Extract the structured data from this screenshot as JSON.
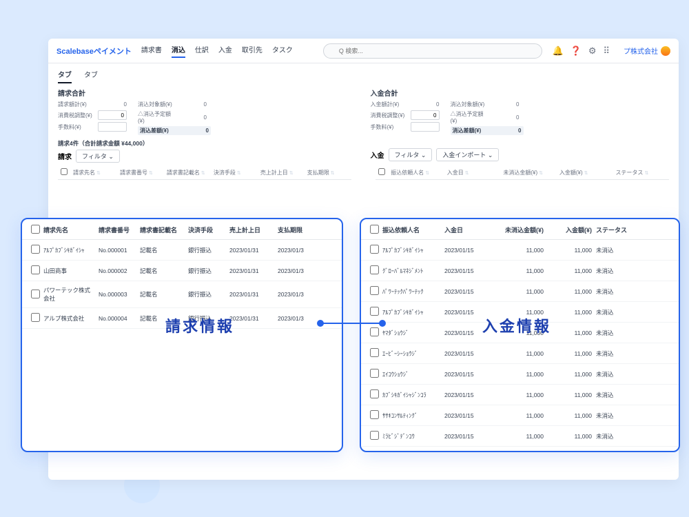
{
  "brand": "Scalebaseペイメント",
  "nav": [
    "請求書",
    "消込",
    "仕訳",
    "入金",
    "取引先",
    "タスク"
  ],
  "nav_active": 1,
  "search_placeholder": "Q 検索...",
  "user": "プ株式会社",
  "subtabs": [
    "タブ",
    "タブ"
  ],
  "left_panel": {
    "title": "請求合計",
    "rows_a": [
      {
        "lbl": "請求額計(¥)",
        "val": "0",
        "input": false
      },
      {
        "lbl": "消費税調整(¥)",
        "val": "0",
        "input": true
      },
      {
        "lbl": "手数料(¥)",
        "val": "",
        "input": true
      }
    ],
    "rows_b": [
      {
        "lbl": "消込対象額(¥)",
        "val": "0",
        "input": false
      },
      {
        "lbl": "△消込予定額(¥)",
        "val": "0",
        "input": false
      },
      {
        "lbl": "消込差額(¥)",
        "val": "0",
        "input": false,
        "hl": true
      }
    ]
  },
  "right_panel": {
    "title": "入金合計",
    "rows_a": [
      {
        "lbl": "入金額計(¥)",
        "val": "0",
        "input": false
      },
      {
        "lbl": "消費税調整(¥)",
        "val": "0",
        "input": true
      },
      {
        "lbl": "手数料(¥)",
        "val": "",
        "input": true
      }
    ],
    "rows_b": [
      {
        "lbl": "消込対象額(¥)",
        "val": "0",
        "input": false
      },
      {
        "lbl": "△消込予定額(¥)",
        "val": "0",
        "input": false
      },
      {
        "lbl": "消込差額(¥)",
        "val": "0",
        "input": false,
        "hl": true
      }
    ]
  },
  "count_text": "請求4件（合計請求金額 ¥44,000）",
  "list_left_title": "請求",
  "list_right_title": "入金",
  "filter": "フィルタ ⌄",
  "import": "入金インポート ⌄",
  "bg_cols_left": [
    "",
    "請求先名",
    "請求書番号",
    "請求書記載名",
    "決済手段",
    "売上計上日",
    "支払期限"
  ],
  "bg_cols_right": [
    "",
    "振込依頼人名",
    "入金日",
    "未消込金額(¥)",
    "入金額(¥)",
    "ステータス"
  ],
  "ov_left": {
    "headers": [
      "",
      "請求先名",
      "請求書番号",
      "請求書記載名",
      "決済手段",
      "売上計上日",
      "支払期限"
    ],
    "rows": [
      [
        "",
        "ｱﾙﾌﾟｶﾌﾞｼｷｶﾞｲｼｬ",
        "No.000001",
        "記載名",
        "銀行振込",
        "2023/01/31",
        "2023/01/3"
      ],
      [
        "",
        "山田商事",
        "No.000002",
        "記載名",
        "銀行振込",
        "2023/01/31",
        "2023/01/3"
      ],
      [
        "",
        "パワーテック株式会社",
        "No.000003",
        "記載名",
        "銀行振込",
        "2023/01/31",
        "2023/01/3"
      ],
      [
        "",
        "アルプ株式会社",
        "No.000004",
        "記載名",
        "銀行振込",
        "2023/01/31",
        "2023/01/3"
      ]
    ]
  },
  "ov_right": {
    "headers": [
      "",
      "振込依頼人名",
      "入金日",
      "未消込金額(¥)",
      "入金額(¥)",
      "ステータス"
    ],
    "rows": [
      [
        "",
        "ｱﾙﾌﾟｶﾌﾞｼｷｶﾞｲｼｬ",
        "2023/01/15",
        "11,000",
        "11,000",
        "未消込"
      ],
      [
        "",
        "ｸﾞﾛｰﾊﾞﾙﾏﾈｼﾞﾒﾝﾄ",
        "2023/01/15",
        "11,000",
        "11,000",
        "未消込"
      ],
      [
        "",
        "ﾊﾟﾜｰﾃｯｸﾊﾟﾜｰﾃｯｸ",
        "2023/01/15",
        "11,000",
        "11,000",
        "未消込"
      ],
      [
        "",
        "ｱﾙﾌﾟｶﾌﾞｼｷｶﾞｲｼｬ",
        "2023/01/15",
        "11,000",
        "11,000",
        "未消込"
      ],
      [
        "",
        "ﾔﾏﾀﾞｼｮｳｼﾞ",
        "2023/01/15",
        "11,000",
        "11,000",
        "未消込"
      ],
      [
        "",
        "ｴｰﾋﾞｰｼｰｼｮｳｼﾞ",
        "2023/01/15",
        "11,000",
        "11,000",
        "未消込"
      ],
      [
        "",
        "ｴｲｺｳｼｮｳｼﾞ",
        "2023/01/15",
        "11,000",
        "11,000",
        "未消込"
      ],
      [
        "",
        "ｶﾌﾞｼｷｶﾞｲｼｬｼﾞﾝｺﾗ",
        "2023/01/15",
        "11,000",
        "11,000",
        "未消込"
      ],
      [
        "",
        "ｻｻｷｺﾝｻﾙﾃｨﾝｸﾞ",
        "2023/01/15",
        "11,000",
        "11,000",
        "未消込"
      ],
      [
        "",
        "ﾐﾗﾋﾞｼﾞﾃﾞﾝｺｳ",
        "2023/01/15",
        "11,000",
        "11,000",
        "未消込"
      ]
    ]
  },
  "label_left": "請求情報",
  "label_right": "入金情報"
}
